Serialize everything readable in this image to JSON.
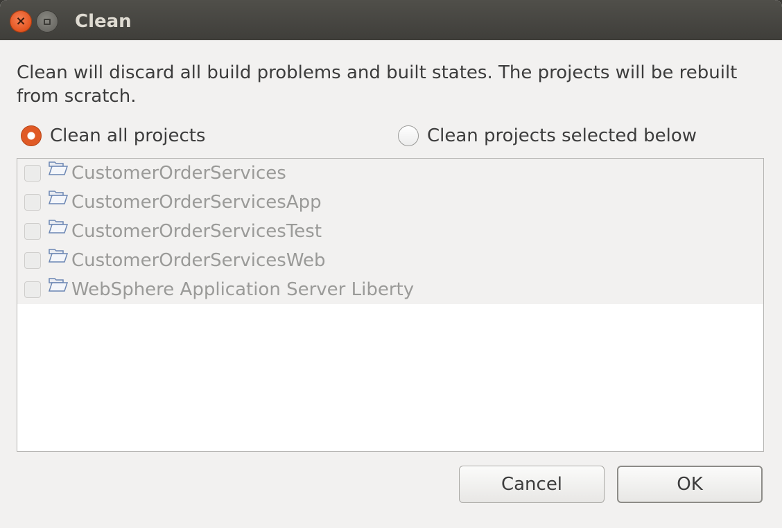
{
  "window": {
    "title": "Clean"
  },
  "description": "Clean will discard all build problems and built states.  The projects will be rebuilt from scratch.",
  "options": {
    "all_label": "Clean all projects",
    "all_selected": true,
    "selected_label": "Clean projects selected below",
    "selected_selected": false
  },
  "projects": [
    {
      "name": "CustomerOrderServices",
      "checked": false
    },
    {
      "name": "CustomerOrderServicesApp",
      "checked": false
    },
    {
      "name": "CustomerOrderServicesTest",
      "checked": false
    },
    {
      "name": "CustomerOrderServicesWeb",
      "checked": false
    },
    {
      "name": "WebSphere Application Server Liberty",
      "checked": false
    }
  ],
  "buttons": {
    "cancel_label": "Cancel",
    "ok_label": "OK"
  },
  "icons": {
    "close": "close-icon",
    "maximize": "maximize-icon",
    "folder": "open-folder-icon"
  },
  "colors": {
    "accent": "#e05a26",
    "titlebar": "#45443f",
    "disabled_text": "#9a9a98"
  }
}
